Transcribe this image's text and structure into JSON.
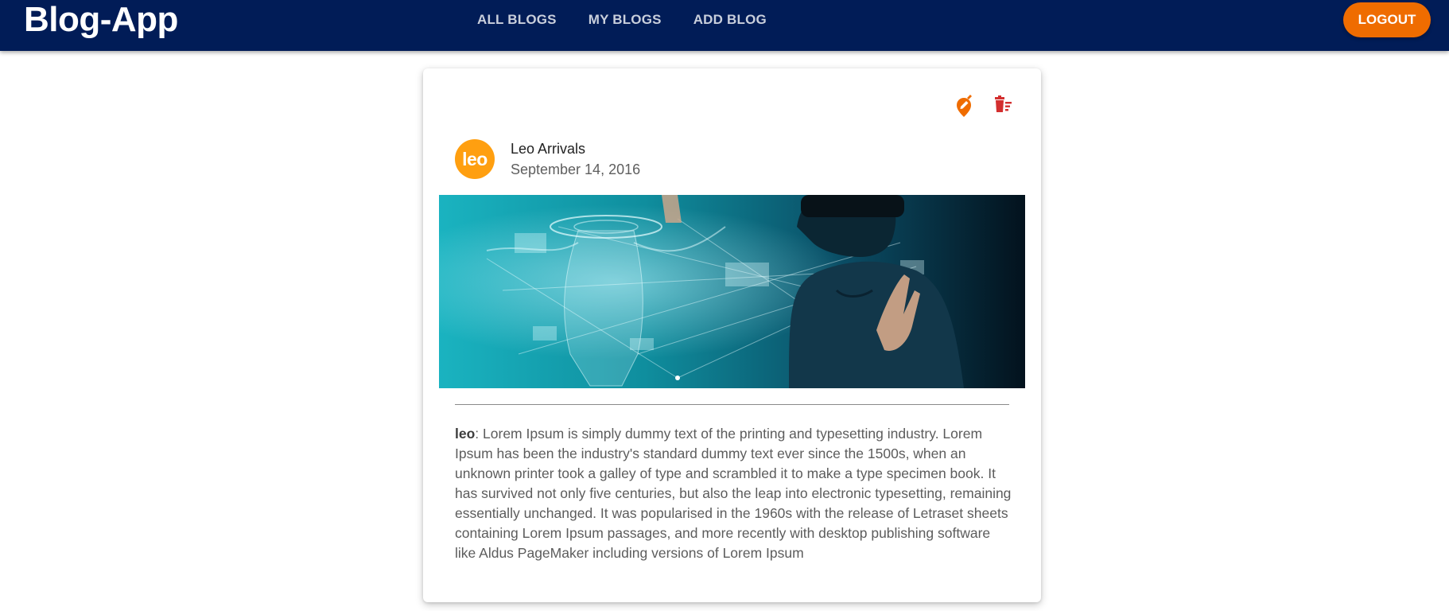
{
  "app": {
    "title": "Blog-App"
  },
  "nav": {
    "tabs": [
      {
        "label": "ALL BLOGS"
      },
      {
        "label": "MY BLOGS"
      },
      {
        "label": "ADD BLOG"
      }
    ],
    "logout_label": "LOGOUT"
  },
  "post": {
    "actions": {
      "edit_icon": "edit-icon",
      "delete_icon": "delete-icon"
    },
    "avatar_text": "leo",
    "author": "Leo Arrivals",
    "date": "September 14, 2016",
    "image_description_icon": "vr-hologram-image",
    "body_user": "leo",
    "body_text": ": Lorem Ipsum is simply dummy text of the printing and typesetting industry. Lorem Ipsum has been the industry's standard dummy text ever since the 1500s, when an unknown printer took a galley of type and scrambled it to make a type specimen book. It has survived not only five centuries, but also the leap into electronic typesetting, remaining essentially unchanged. It was popularised in the 1960s with the release of Letraset sheets containing Lorem Ipsum passages, and more recently with desktop publishing software like Aldus PageMaker including versions of Lorem Ipsum"
  },
  "colors": {
    "appbar": "#011c57",
    "accent": "#ef6c00",
    "avatar": "#ff9f10",
    "delete": "#d32f2f"
  }
}
